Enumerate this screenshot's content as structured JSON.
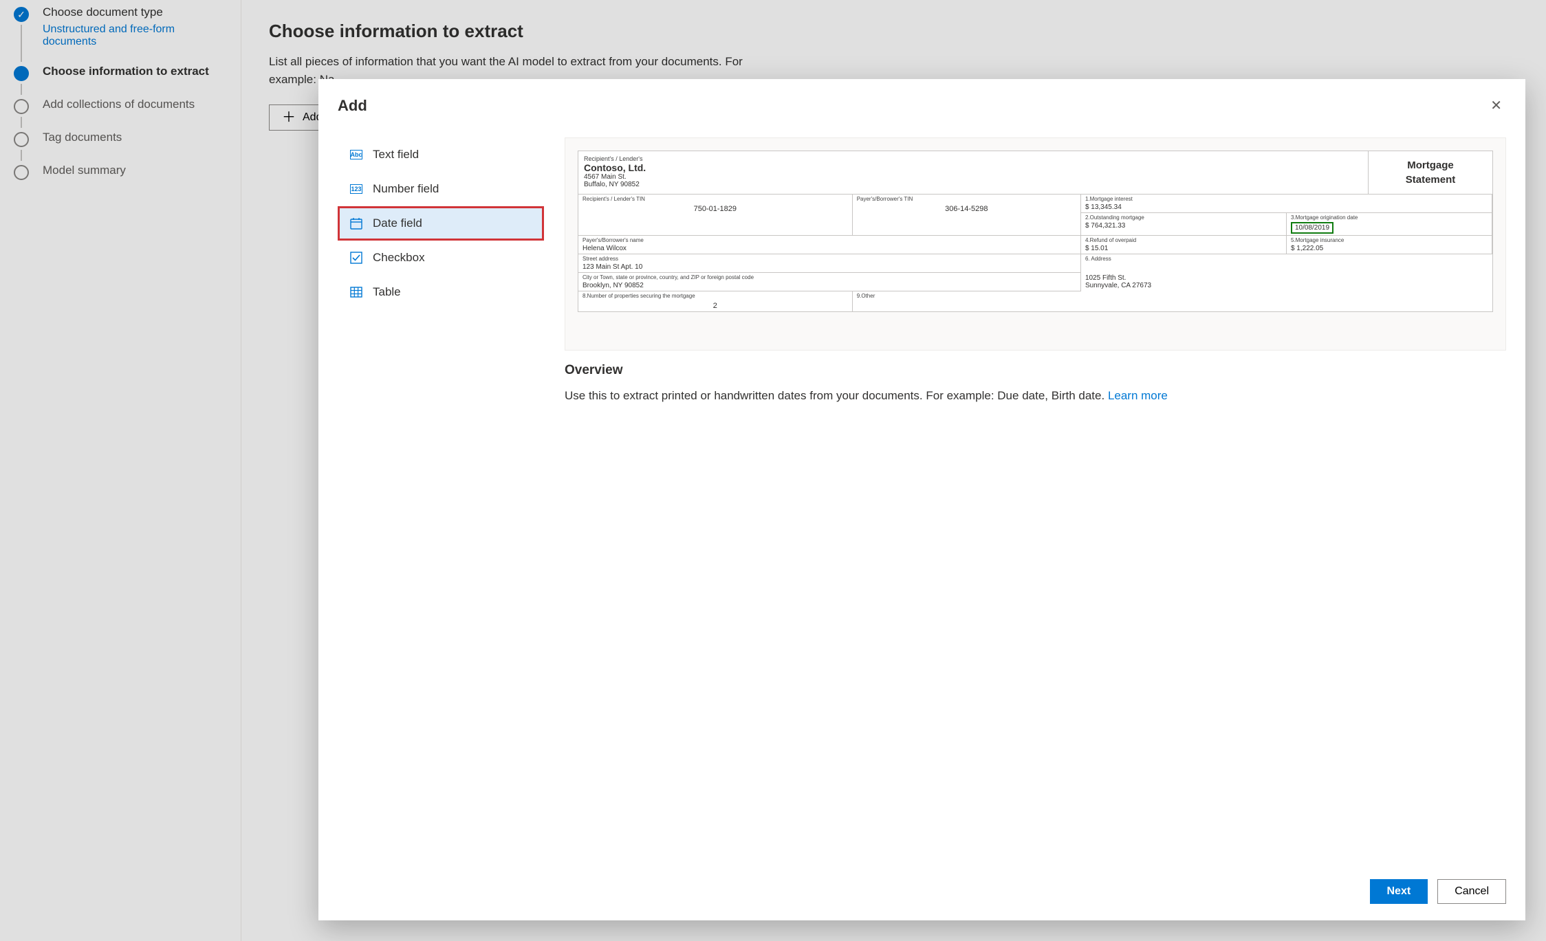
{
  "sidebar": {
    "steps": [
      {
        "label": "Choose document type",
        "sub": "Unstructured and free-form documents",
        "state": "done"
      },
      {
        "label": "Choose information to extract",
        "state": "active"
      },
      {
        "label": "Add collections of documents",
        "state": "pending"
      },
      {
        "label": "Tag documents",
        "state": "pending"
      },
      {
        "label": "Model summary",
        "state": "pending"
      }
    ]
  },
  "main": {
    "title": "Choose information to extract",
    "desc": "List all pieces of information that you want the AI model to extract from your documents. For example: Na",
    "add_button": "Add"
  },
  "modal": {
    "title": "Add",
    "fields": {
      "text": {
        "label": "Text field",
        "icon": "Abc"
      },
      "number": {
        "label": "Number field",
        "icon": "123"
      },
      "date": {
        "label": "Date field"
      },
      "checkbox": {
        "label": "Checkbox"
      },
      "table": {
        "label": "Table"
      }
    },
    "overview": {
      "heading": "Overview",
      "text": "Use this to extract printed or handwritten dates from your documents. For example: Due date, Birth date. ",
      "link": "Learn more"
    },
    "buttons": {
      "next": "Next",
      "cancel": "Cancel"
    }
  },
  "doc": {
    "lender_label": "Recipient's / Lender's",
    "company": "Contoso, Ltd.",
    "addr1": "4567 Main St.",
    "addr2": "Buffalo, NY 90852",
    "title1": "Mortgage",
    "title2": "Statement",
    "tin_label1": "Recipient's / Lender's TIN",
    "tin1": "750-01-1829",
    "tin_label2": "Payer's/Borrower's TIN",
    "tin2": "306-14-5298",
    "f1l": "1.Mortgage interest",
    "f1v": "$  13,345.34",
    "f2l": "2.Outstanding mortgage",
    "f2v": "$  764,321.33",
    "f3l": "3.Mortgage origination date",
    "f3v": "10/08/2019",
    "f4l": "4.Refund of overpaid",
    "f4v": "$  15.01",
    "f5l": "5.Mortgage insurance",
    "f5v": "$  1,222.05",
    "f6l": "6. Address",
    "borrower_label": "Payer's/Borrower's name",
    "borrower": "Helena Wilcox",
    "street_label": "Street address",
    "street": "123 Main St Apt. 10",
    "city_label": "City or Town, state or province, country, and ZIP or foreign postal code",
    "city": "Brooklyn, NY 90852",
    "prop_label": "8.Number of properties securing the mortgage",
    "prop": "2",
    "other_label": "9.Other",
    "addr_out1": "1025 Fifth St.",
    "addr_out2": "Sunnyvale, CA 27673"
  }
}
